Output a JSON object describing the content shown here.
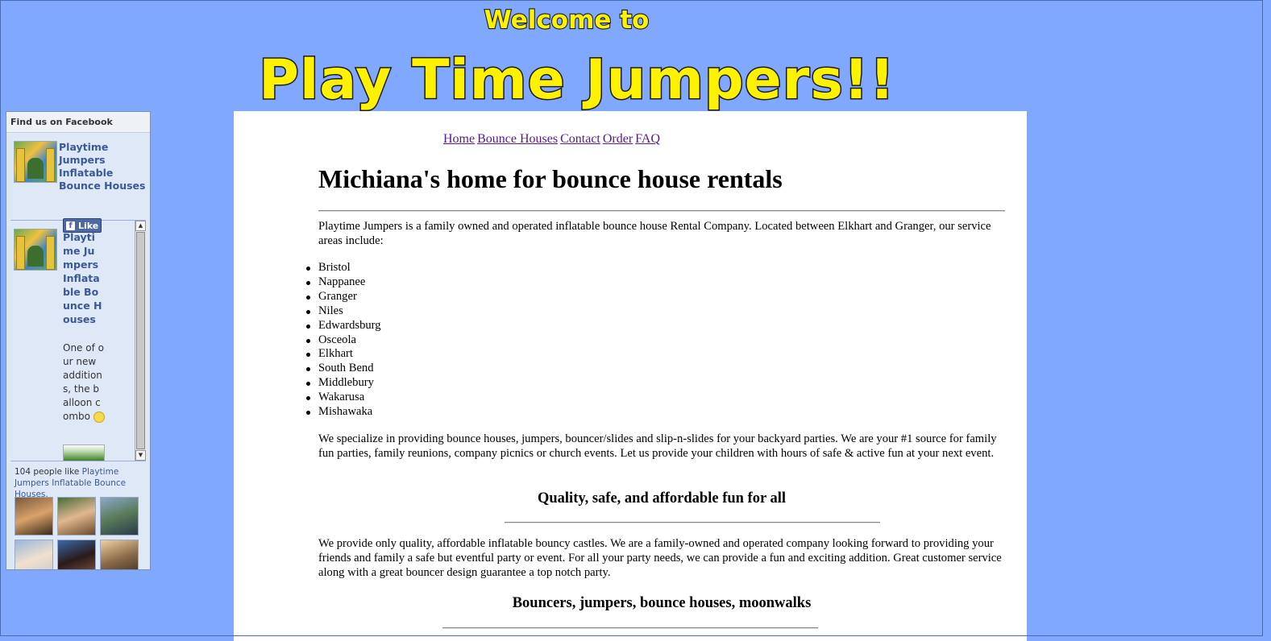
{
  "banner": {
    "welcome": "Welcome to",
    "title": "Play Time Jumpers!!"
  },
  "facebook": {
    "header": "Find us on Facebook",
    "page_name": "Playtime Jumpers Inflatable Bounce Houses",
    "like_label": "Like",
    "post_author": "Playtime Jumpers Inflatable Bounce Houses",
    "post_text": "One of our new additions, the balloon combo",
    "count_text": "104 people like",
    "page_link": "Playtime Jumpers Inflatable Bounce Houses."
  },
  "nav": {
    "items": [
      "Home",
      "Bounce Houses",
      "Contact",
      "Order",
      "FAQ"
    ]
  },
  "main": {
    "heading": "Michiana's home for bounce house rentals",
    "intro": "Playtime Jumpers is a family owned and operated inflatable bounce house Rental Company. Located between Elkhart and Granger, our service areas include:",
    "areas": [
      "Bristol",
      "Nappanee",
      "Granger",
      "Niles",
      "Edwardsburg",
      "Osceola",
      "Elkhart",
      "South Bend",
      "Middlebury",
      "Wakarusa",
      "Mishawaka"
    ],
    "specialize": "We specialize in providing bounce houses, jumpers, bouncer/slides and slip-n-slides for your backyard parties. We are your #1 source for family fun parties, family reunions, company picnics or church events. Let us provide your children with hours of safe & active fun at your next event.",
    "sub1": "Quality, safe, and affordable fun for all",
    "quality": "We provide only quality, affordable inflatable bouncy castles. We are a family-owned and operated company looking forward to providing your friends and family a safe but eventful party or event. For all your party needs, we can provide a fun and exciting addition. Great customer service along with a great bouncer design guarantee a top notch party.",
    "sub2": "Bouncers, jumpers, bounce houses, moonwalks"
  }
}
